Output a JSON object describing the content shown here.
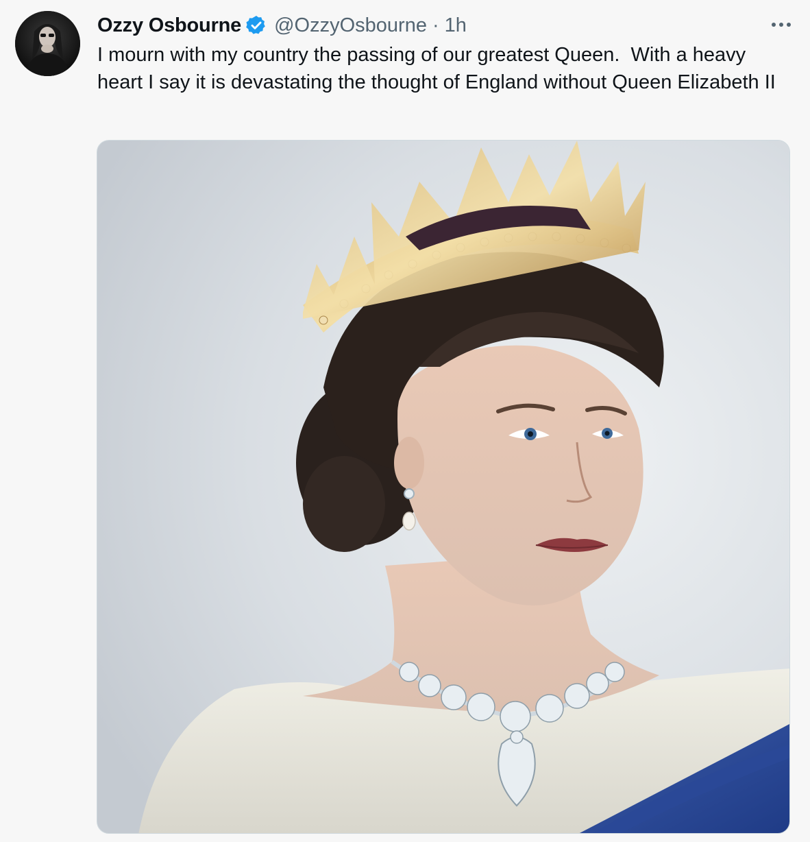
{
  "tweet": {
    "display_name": "Ozzy Osbourne",
    "handle": "@OzzyOsbourne",
    "separator": "·",
    "time": "1h",
    "text": "I mourn with my country the passing of our greatest Queen.  With a heavy heart I say it is devastating the thought of England without Queen Elizabeth II",
    "more_icon": "more-horizontal-icon",
    "verified_icon": "verified-badge-icon",
    "verified_color": "#1d9bf0"
  },
  "media": {
    "kind": "photo",
    "subject": "portrait"
  },
  "colors": {
    "background": "#f7f7f7",
    "text_primary": "#0f1419",
    "text_secondary": "#536471",
    "media_border": "#cfd9de"
  }
}
